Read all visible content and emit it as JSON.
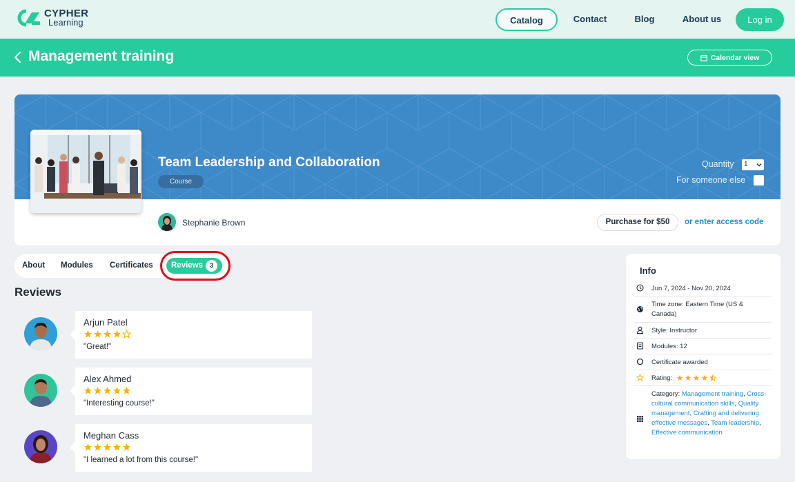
{
  "brand": {
    "name_line1": "CYPHER",
    "name_line2": "Learning"
  },
  "nav": {
    "catalog": "Catalog",
    "contact": "Contact",
    "blog": "Blog",
    "about": "About us",
    "login": "Log in"
  },
  "header": {
    "title": "Management training",
    "calendar_view": "Calendar view"
  },
  "course": {
    "title": "Team Leadership and Collaboration",
    "badge": "Course",
    "quantity_label": "Quantity",
    "quantity_value": "1",
    "for_someone_label": "For someone else",
    "instructor": "Stephanie Brown",
    "purchase_label": "Purchase for $50",
    "access_code_label": "or enter access code"
  },
  "tabs": {
    "about": "About",
    "modules": "Modules",
    "certificates": "Certificates",
    "reviews": "Reviews",
    "reviews_count": "3"
  },
  "reviews_heading": "Reviews",
  "reviews": [
    {
      "name": "Arjun Patel",
      "rating": 4,
      "text": "\"Great!\""
    },
    {
      "name": "Alex Ahmed",
      "rating": 5,
      "text": "\"Interesting course!\""
    },
    {
      "name": "Meghan Cass",
      "rating": 5,
      "text": "\"I learned a lot from this course!\""
    }
  ],
  "info": {
    "title": "Info",
    "dates": "Jun 7, 2024 - Nov 20, 2024",
    "timezone": "Time zone: Eastern Time (US & Canada)",
    "style": "Style: Instructor",
    "modules": "Modules: 12",
    "certificate": "Certificate awarded",
    "rating_label": "Rating:",
    "rating_value": 4.5,
    "category_label": "Category:",
    "categories": [
      "Management training",
      "Cross-cultural communication skills",
      "Quality management",
      "Crafting and delivering effective messages",
      "Team leadership",
      "Effective communication"
    ]
  },
  "colors": {
    "brand_green": "#26cc9c",
    "banner_blue": "#3e89c8",
    "link_blue": "#1f8fd6",
    "star_gold": "#f5b400",
    "highlight_red": "#e00e1c"
  },
  "icons": [
    "back-chevron-icon",
    "calendar-icon",
    "clock-icon",
    "globe-icon",
    "user-icon",
    "book-icon",
    "circle-icon",
    "star-icon",
    "grid-icon"
  ]
}
